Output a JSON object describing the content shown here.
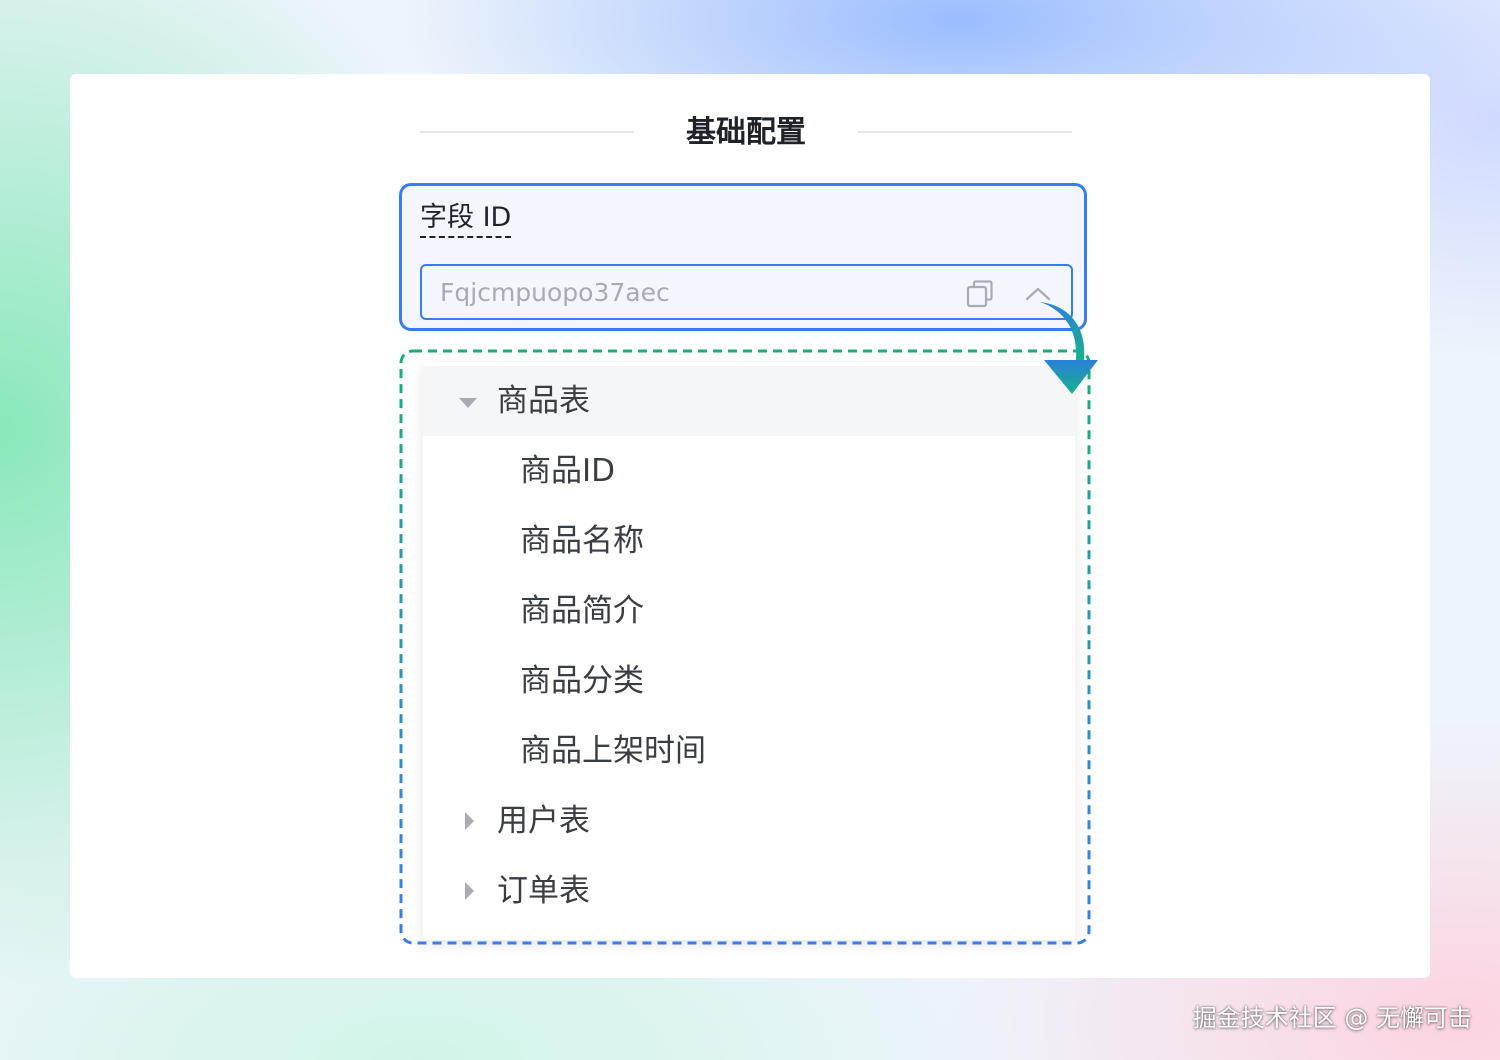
{
  "section": {
    "title": "基础配置"
  },
  "field": {
    "label": "字段 ID",
    "value": "Fqjcmpuopo37aec"
  },
  "tree": {
    "groups": [
      {
        "label": "商品表",
        "expanded": true,
        "children": [
          "商品ID",
          "商品名称",
          "商品简介",
          "商品分类",
          "商品上架时间"
        ]
      },
      {
        "label": "用户表",
        "expanded": false
      },
      {
        "label": "订单表",
        "expanded": false
      }
    ]
  },
  "watermark": "掘金技术社区 @ 无懈可击",
  "colors": {
    "accent_blue": "#3a7bf0",
    "dash_green": "#1aad7a",
    "dash_blue": "#3a7bf0",
    "arrow_top": "#2b7fd8",
    "arrow_bottom": "#16b38a"
  }
}
